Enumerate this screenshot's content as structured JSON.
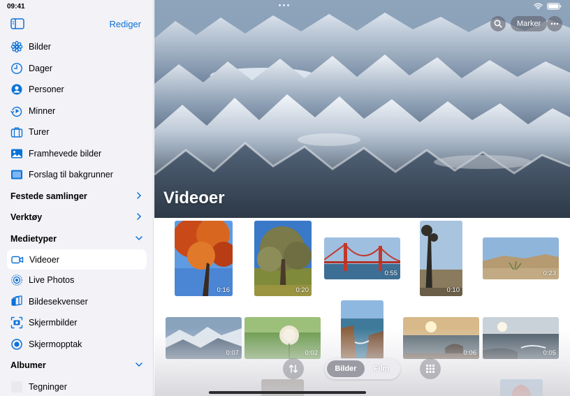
{
  "status": {
    "time": "09:41"
  },
  "sidebar": {
    "edit_label": "Rediger",
    "items": [
      {
        "label": "Bilder",
        "icon": "flower-icon"
      },
      {
        "label": "Dager",
        "icon": "clock-icon"
      },
      {
        "label": "Personer",
        "icon": "person-circle-icon"
      },
      {
        "label": "Minner",
        "icon": "memories-icon"
      },
      {
        "label": "Turer",
        "icon": "suitcase-icon"
      },
      {
        "label": "Framhevede bilder",
        "icon": "photo-icon"
      },
      {
        "label": "Forslag til bakgrunner",
        "icon": "wallpaper-icon"
      }
    ],
    "pinned_label": "Festede samlinger",
    "tools_label": "Verktøy",
    "media_types_label": "Medietyper",
    "media_types": [
      {
        "label": "Videoer",
        "icon": "video-icon",
        "selected": true
      },
      {
        "label": "Live Photos",
        "icon": "live-photo-icon"
      },
      {
        "label": "Bildesekvenser",
        "icon": "burst-icon"
      },
      {
        "label": "Skjermbilder",
        "icon": "screenshot-icon"
      },
      {
        "label": "Skjermopptak",
        "icon": "screen-record-icon"
      }
    ],
    "albums_label": "Albumer",
    "albums": [
      {
        "label": "Tegninger"
      }
    ]
  },
  "main": {
    "title": "Videoer",
    "select_label": "Marker",
    "thumbnails": [
      {
        "duration": "0:16"
      },
      {
        "duration": "0:20"
      },
      {
        "duration": "0:55"
      },
      {
        "duration": "0:10"
      },
      {
        "duration": "0:23"
      },
      {
        "duration": "0:07"
      },
      {
        "duration": "0:02"
      },
      {
        "duration": "0:06"
      },
      {
        "duration": "0:05"
      }
    ],
    "segment": {
      "photos": "Bilder",
      "movies": "Film",
      "selected": "Bilder"
    }
  },
  "colors": {
    "accent": "#0a72d8",
    "sidebar_bg": "#f2f2f7"
  }
}
